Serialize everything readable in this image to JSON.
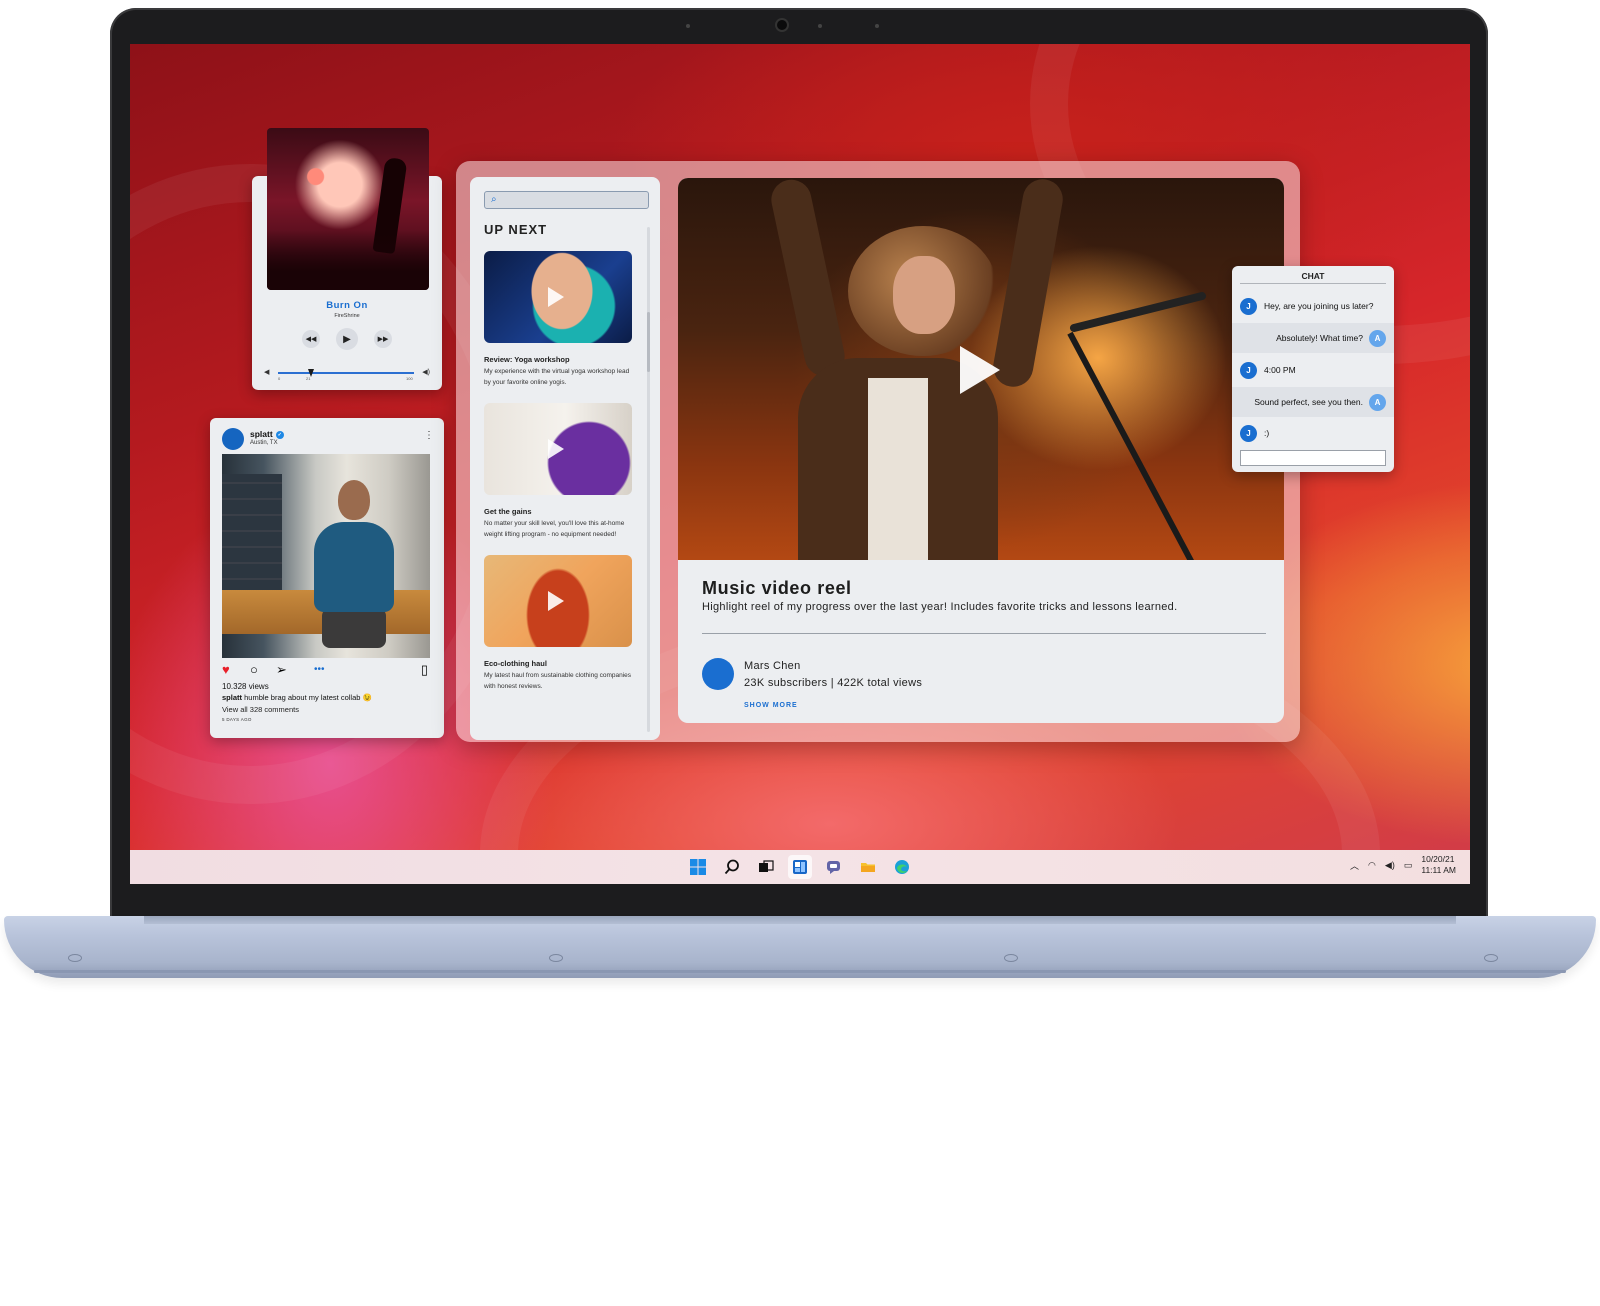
{
  "music_player": {
    "title": "Burn On",
    "artist": "FireShrine",
    "prev_icon": "previous-icon",
    "play_icon": "play-icon",
    "next_icon": "next-icon",
    "volume_low_icon": "volume-low-icon",
    "volume_high_icon": "volume-high-icon",
    "scale_min": "0",
    "scale_mid": "21",
    "scale_max": "100"
  },
  "social_post": {
    "username": "splatt",
    "location": "Austin, TX",
    "views": "10.328 views",
    "caption_user": "splatt",
    "caption_text": "humble brag about my latest collab 😉",
    "comments": "View all 328 comments",
    "time_ago": "5 DAYS AGO",
    "icons": [
      "heart-icon",
      "comment-icon",
      "share-icon",
      "more-icon",
      "bookmark-icon"
    ]
  },
  "up_next": {
    "heading": "UP NEXT",
    "search_placeholder": "",
    "videos": [
      {
        "title": "Review: Yoga workshop",
        "desc": "My experience with the virtual yoga workshop lead by your favorite online yogis."
      },
      {
        "title": "Get the gains",
        "desc": "No matter your skill level, you'll love this at-home weight lifting program - no equipment needed!"
      },
      {
        "title": "Eco-clothing haul",
        "desc": "My latest haul from sustainable clothing companies with honest reviews."
      }
    ]
  },
  "video": {
    "title": "Music video reel",
    "description": "Highlight reel of my progress over the last year! Includes favorite tricks and lessons learned.",
    "channel": "Mars Chen",
    "stats": "23K subscribers | 422K total views",
    "show_more": "SHOW MORE"
  },
  "chat": {
    "heading": "CHAT",
    "messages": [
      {
        "from": "J",
        "text": "Hey, are you joining us later?"
      },
      {
        "from": "A",
        "text": "Absolutely! What time?"
      },
      {
        "from": "J",
        "text": "4:00 PM"
      },
      {
        "from": "A",
        "text": "Sound perfect, see you then."
      },
      {
        "from": "J",
        "text": ":)"
      }
    ]
  },
  "taskbar": {
    "date": "10/20/21",
    "time": "11:11 AM",
    "apps": [
      "windows-start-icon",
      "search-icon",
      "task-view-icon",
      "widgets-icon",
      "teams-chat-icon",
      "file-explorer-icon",
      "edge-browser-icon"
    ]
  },
  "colors": {
    "accent": "#1a6ed0",
    "heart": "#e8202a"
  }
}
